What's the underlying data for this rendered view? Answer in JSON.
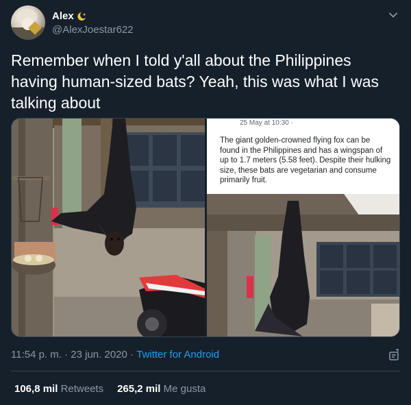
{
  "author": {
    "name": "Alex",
    "name_emoji": "crescent-moon-sparkle-icon",
    "handle": "@AlexJoestar622"
  },
  "tweet": {
    "text": "Remember when I told y'all about the Philippines having human-sized bats? Yeah, this was what I was talking about"
  },
  "media": {
    "right_caption": {
      "date": "25 May at 10:30 · ",
      "text": "The giant golden-crowned flying fox can be found in the Philippines and has a wingspan of up to 1.7 meters (5.58 feet). Despite their hulking size, these bats are vegetarian and consume primarily fruit."
    }
  },
  "meta": {
    "time": "11:54 p. m.",
    "separator1": " · ",
    "date": "23 jun. 2020",
    "separator2": " · ",
    "client": "Twitter for Android"
  },
  "stats": {
    "retweets_count": "106,8 mil",
    "retweets_label": "Retweets",
    "likes_count": "265,2 mil",
    "likes_label": "Me gusta"
  },
  "colors": {
    "background": "#15202b",
    "text_secondary": "#8899a6",
    "link": "#1da1f2",
    "border": "#38444d"
  }
}
